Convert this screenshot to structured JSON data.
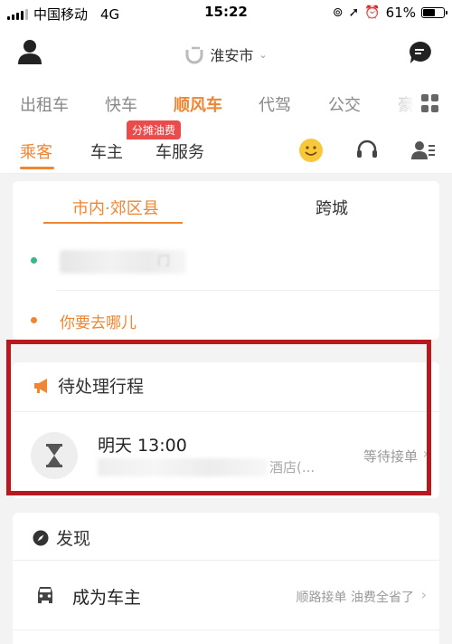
{
  "status_bar": {
    "carrier": "中国移动",
    "network": "4G",
    "time": "15:22",
    "battery": "61%",
    "battery_level": 0.61
  },
  "header": {
    "city": "淮安市",
    "city_arrow": "⌄"
  },
  "service_tabs": [
    "出租车",
    "快车",
    "顺风车",
    "代驾",
    "公交",
    "豪"
  ],
  "active_service": "顺风车",
  "promo_badge": "分摊油费",
  "role_tabs": [
    "乘客",
    "车主",
    "车服务"
  ],
  "active_role": "乘客",
  "route_card": {
    "tabs": [
      "市内·郊区县",
      "跨城"
    ],
    "from_visible": "门",
    "destination_placeholder": "你要去哪儿"
  },
  "pending": {
    "title": "待处理行程",
    "trip_time": "明天 13:00",
    "trip_addr_prefix": "",
    "trip_addr_suffix": "酒店(...",
    "trip_status": "等待接单",
    "chevron": "›"
  },
  "discover": {
    "title": "发现",
    "item_label": "成为车主",
    "item_desc": "顺路接单 油费全省了",
    "chevron": "›"
  },
  "colors": {
    "accent": "#f08532",
    "highlight": "#b8191e",
    "badge": "#ea4b4b",
    "origin_dot": "#3bb58a",
    "dest_dot": "#f08532"
  }
}
